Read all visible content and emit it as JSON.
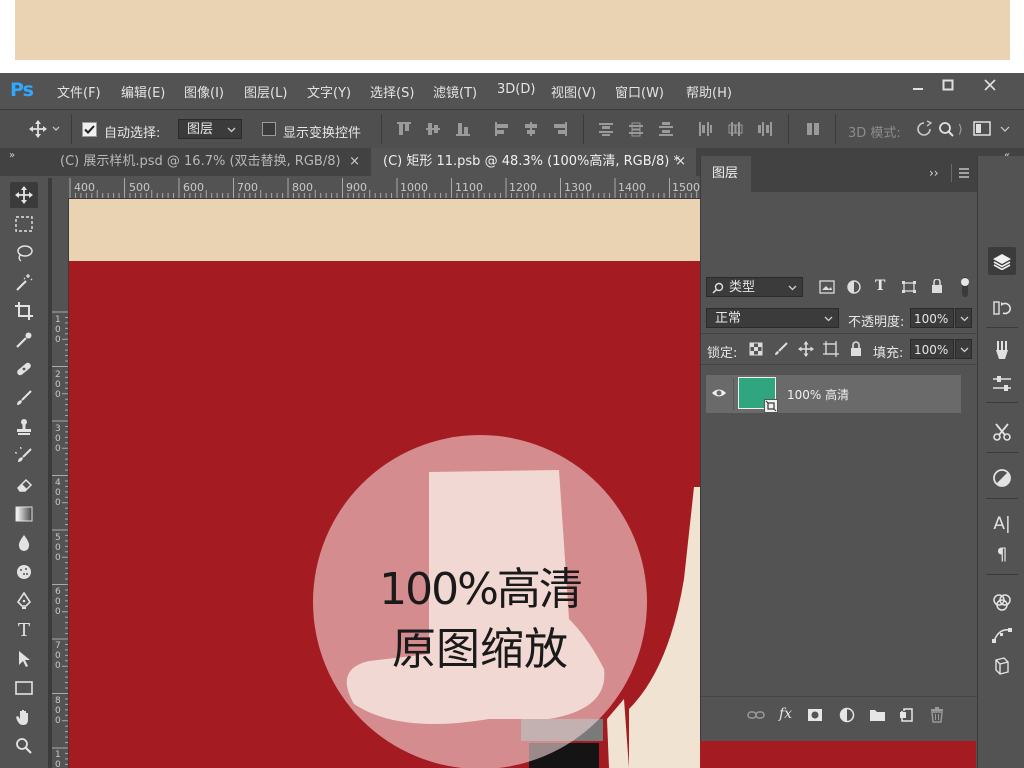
{
  "app": {
    "logo": "Ps"
  },
  "menubar": {
    "items": [
      "文件(F)",
      "编辑(E)",
      "图像(I)",
      "图层(L)",
      "文字(Y)",
      "选择(S)",
      "滤镜(T)",
      "3D(D)",
      "视图(V)",
      "窗口(W)",
      "帮助(H)"
    ],
    "window_controls": [
      "minimize",
      "maximize",
      "close"
    ]
  },
  "options_bar": {
    "auto_select_label": "自动选择:",
    "auto_select_checked": true,
    "auto_select_target": "图层",
    "show_transform_label": "显示变换控件",
    "show_transform_checked": false,
    "mode_3d_label": "3D 模式:"
  },
  "tabs": [
    {
      "label": "(C) 展示样机.psd @ 16.7% (双击替换, RGB/8)",
      "close": "×",
      "active": false
    },
    {
      "label": "(C) 矩形 11.psb @ 48.3% (100%高清, RGB/8) *",
      "close": "×",
      "active": true
    }
  ],
  "ruler_top": [
    "400",
    "500",
    "600",
    "700",
    "800",
    "900",
    "1000",
    "1100",
    "1200",
    "1300",
    "1400",
    "1500"
  ],
  "ruler_left": [
    "1\n0\n0",
    "2\n0\n0",
    "3\n0\n0",
    "4\n0\n0",
    "5\n0\n0",
    "6\n0\n0",
    "7\n0\n0",
    "8\n0\n0",
    "9\n0\n0",
    "1\n0"
  ],
  "tools": [
    "move-tool",
    "marquee-tool",
    "lasso-tool",
    "magic-wand-tool",
    "crop-tool",
    "eyedropper-tool",
    "healing-brush-tool",
    "brush-tool",
    "clone-stamp-tool",
    "history-brush-tool",
    "eraser-tool",
    "gradient-tool",
    "blur-tool",
    "dodge-tool",
    "pen-tool",
    "type-tool",
    "path-selection-tool",
    "rectangle-tool",
    "hand-tool",
    "zoom-tool"
  ],
  "layers_panel": {
    "title": "图层",
    "filter_label": "类型",
    "blend_mode": "正常",
    "opacity_label": "不透明度:",
    "opacity_value": "100%",
    "lock_label": "锁定:",
    "fill_label": "填充:",
    "fill_value": "100%",
    "layers": [
      {
        "name": "100% 高清",
        "visible": true,
        "thumb_color": "#2fa67f"
      }
    ],
    "bottom_icons": [
      "link-icon",
      "fx-icon",
      "mask-icon",
      "adjustment-icon",
      "folder-icon",
      "new-layer-icon",
      "trash-icon"
    ]
  },
  "right_dock": [
    "layers-icon",
    "history-icon",
    "brushes-icon",
    "properties-icon",
    "tools-icon",
    "adjustments-icon",
    "character-icon",
    "paragraph-icon",
    "channels-icon",
    "paths-icon",
    "3d-icon"
  ],
  "overlay": {
    "line1": "100%高清",
    "line2": "原图缩放"
  },
  "colors": {
    "banner": "#e9d3b2",
    "canvas_red": "#a51b22",
    "cream": "#f1e3d1",
    "chrome": "#535353",
    "ps_blue": "#31a8ff"
  }
}
